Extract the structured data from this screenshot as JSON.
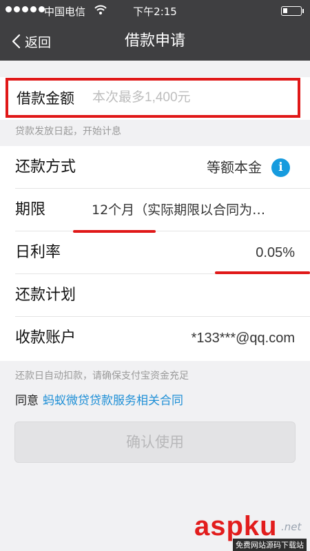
{
  "status_bar": {
    "carrier": "中国电信",
    "time": "下午2:15",
    "signal_bars": 4,
    "signal_total": 5,
    "battery_level": 0.2
  },
  "nav": {
    "back_label": "返回",
    "title": "借款申请"
  },
  "amount": {
    "label": "借款金额",
    "placeholder": "本次最多1,400元"
  },
  "interest_hint": "贷款发放日起，开始计息",
  "rows": [
    {
      "label": "还款方式",
      "value": "等额本金",
      "icon": "info-icon"
    },
    {
      "label": "期限",
      "value": "12个月（实际期限以合同为…"
    },
    {
      "label": "日利率",
      "value": "0.05%"
    },
    {
      "label": "还款计划",
      "value": ""
    },
    {
      "label": "收款账户",
      "value": "*133***@qq.com"
    }
  ],
  "autopay_hint": "还款日自动扣款，请确保支付宝资金充足",
  "agreement": {
    "prefix": "同意",
    "link": "蚂蚁微贷贷款服务相关合同"
  },
  "confirm_button": "确认使用",
  "watermark": {
    "brand": "aspku",
    "tld": ".net",
    "subtitle": "免费网站源码下载站"
  },
  "colors": {
    "header_bg": "#3f3f41",
    "highlight_red": "#e01818",
    "link_blue": "#1e8fd6",
    "info_blue": "#169bde"
  }
}
